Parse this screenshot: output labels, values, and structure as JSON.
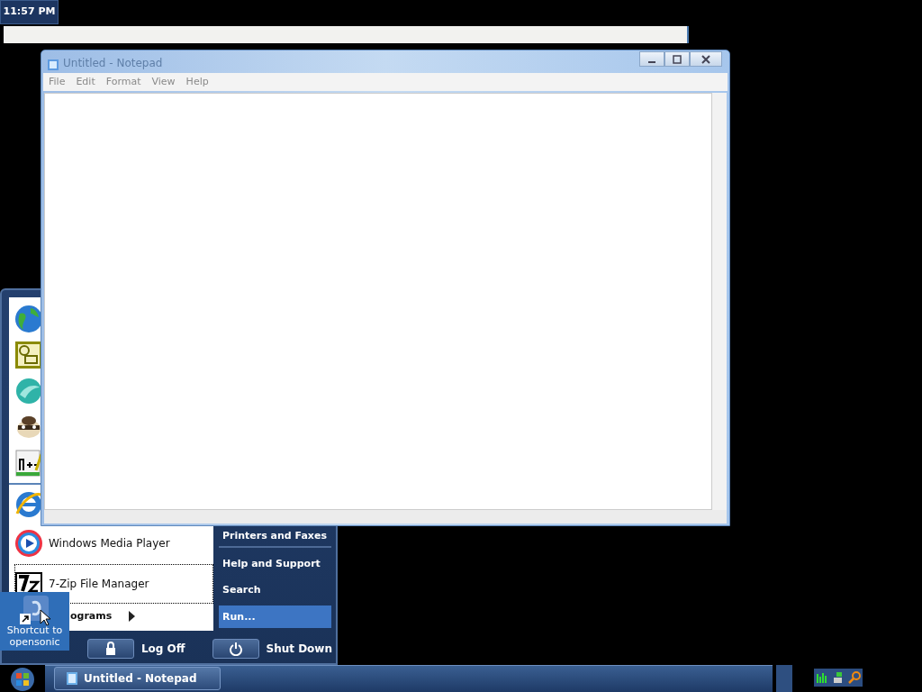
{
  "clock": {
    "time": "11:57 PM"
  },
  "notepad": {
    "title": "Untitled - Notepad",
    "menu": [
      "File",
      "Edit",
      "Format",
      "View",
      "Help"
    ]
  },
  "start_menu": {
    "programs": [
      {
        "label": "Windows Media Player",
        "selected": false
      },
      {
        "label": "7-Zip File Manager",
        "selected": true
      }
    ],
    "all_programs": "ograms",
    "places": [
      {
        "label": "Printers and Faxes",
        "selected": false
      },
      {
        "label": "Help and Support",
        "selected": false
      },
      {
        "label": "Search",
        "selected": false
      },
      {
        "label": "Run...",
        "selected": true
      }
    ],
    "buttons": [
      "Log Off",
      "Shut Down"
    ]
  },
  "desktop_icon": {
    "label": "Shortcut to opensonic",
    "selected": true
  },
  "taskbar": {
    "tasks": [
      {
        "label": "Untitled - Notepad"
      }
    ]
  }
}
